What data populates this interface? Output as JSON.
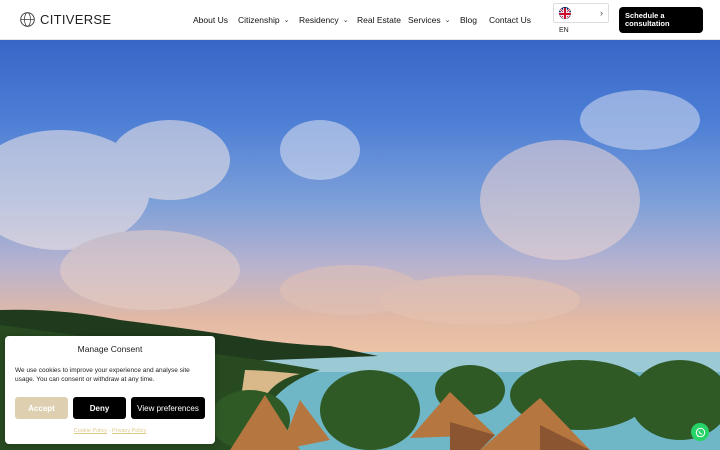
{
  "header": {
    "brand": "CITIVERSE",
    "nav": [
      {
        "label": "About Us",
        "has_dropdown": false
      },
      {
        "label": "Citizenship",
        "has_dropdown": true
      },
      {
        "label": "Residency",
        "has_dropdown": true
      },
      {
        "label": "Real Estate",
        "has_dropdown": false
      },
      {
        "label": "Services",
        "has_dropdown": true
      },
      {
        "label": "Blog",
        "has_dropdown": false
      },
      {
        "label": "Contact Us",
        "has_dropdown": false
      }
    ],
    "language": {
      "code": "EN",
      "flag_icon": "uk-flag-icon"
    },
    "cta_label": "Schedule a consultation"
  },
  "consent": {
    "title": "Manage Consent",
    "text": "We use cookies to improve your experience and analyse site usage. You can consent or withdraw at any time.",
    "accept_label": "Accept",
    "deny_label": "Deny",
    "preferences_label": "View preferences",
    "cookie_policy": "Cookie Policy",
    "separator": "-",
    "privacy_policy": "Privacy Policy"
  },
  "colors": {
    "accent": "#000000",
    "accept_bg": "#ddcfb0",
    "whatsapp": "#25d366"
  },
  "icons": {
    "whatsapp": "whatsapp-icon",
    "dropdown": "chevron-down-icon"
  }
}
